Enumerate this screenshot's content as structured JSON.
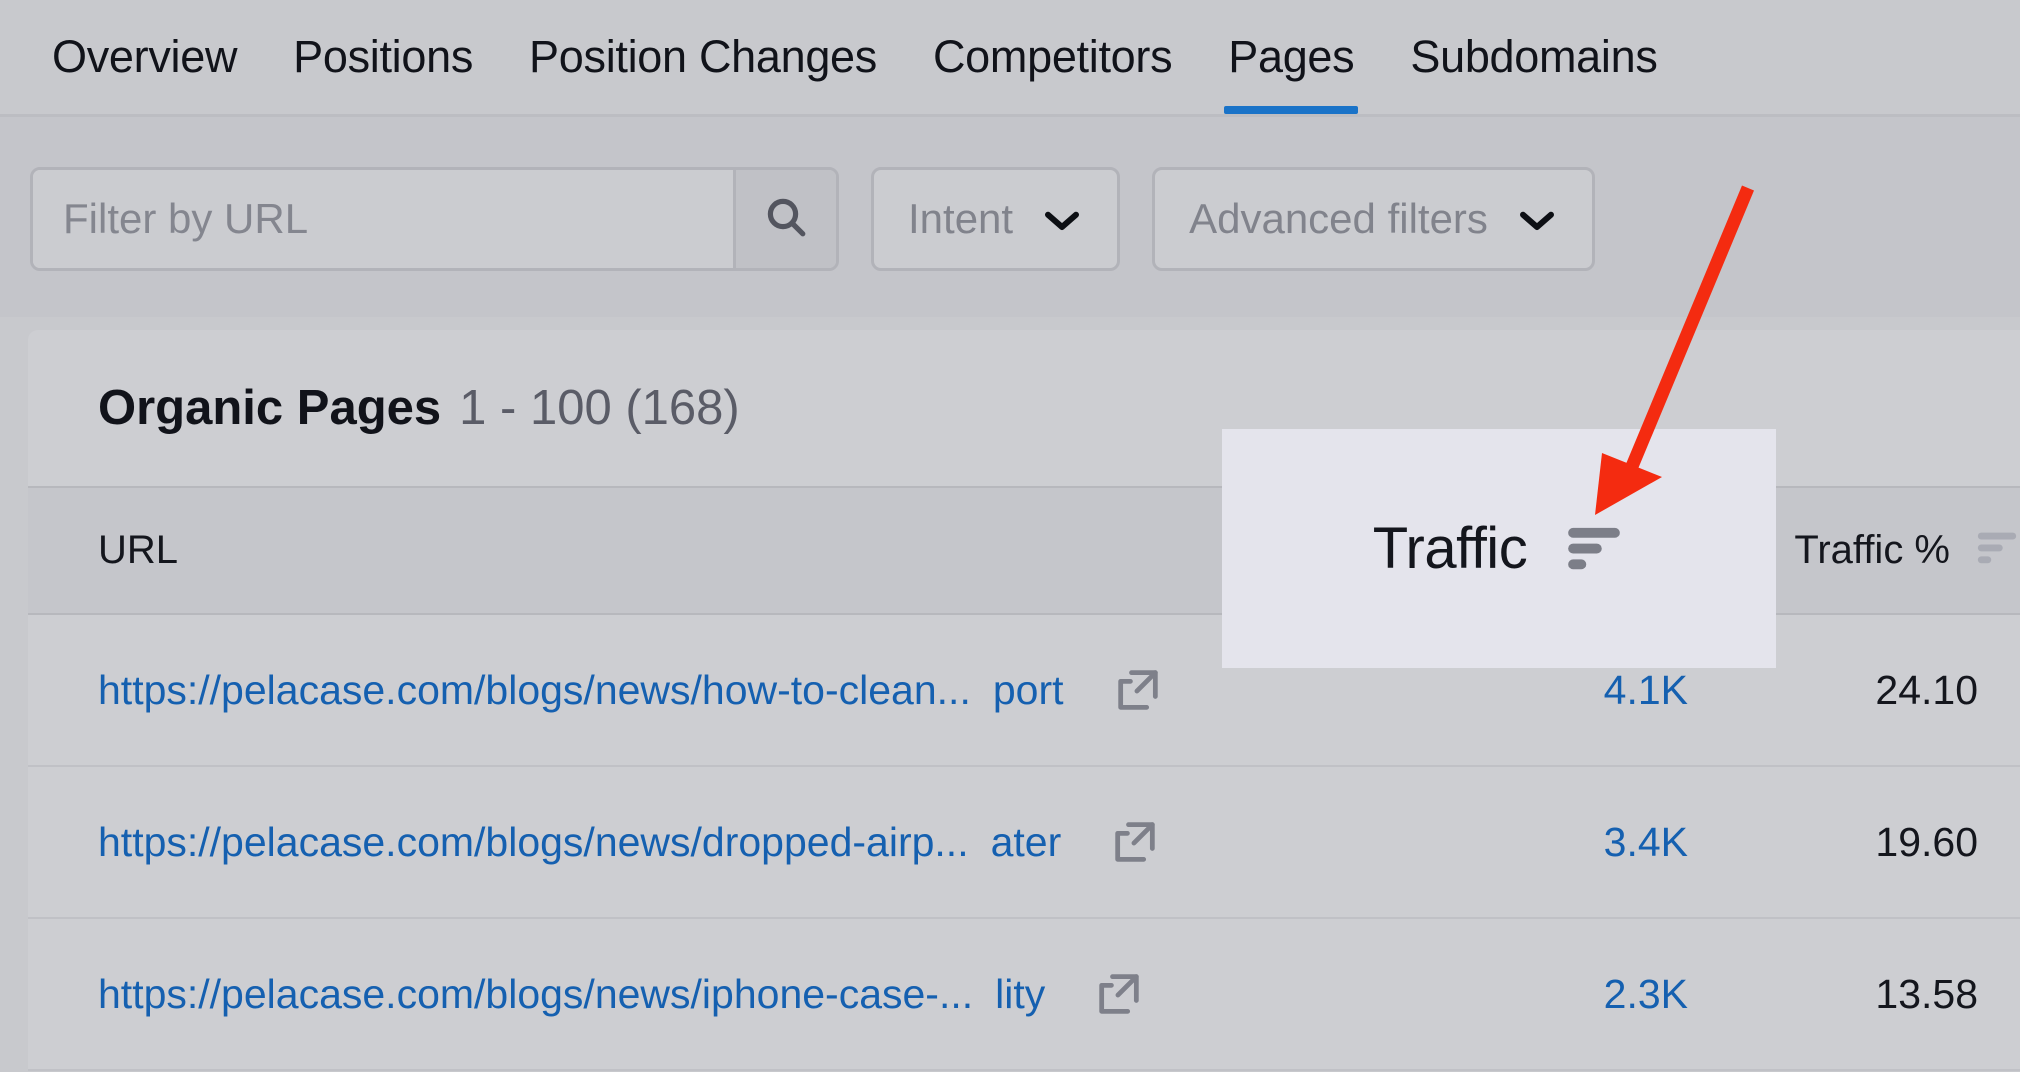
{
  "nav": {
    "tabs": [
      {
        "label": "Overview",
        "active": false
      },
      {
        "label": "Positions",
        "active": false
      },
      {
        "label": "Position Changes",
        "active": false
      },
      {
        "label": "Competitors",
        "active": false
      },
      {
        "label": "Pages",
        "active": true
      },
      {
        "label": "Subdomains",
        "active": false
      }
    ],
    "active_underline_color": "#1a73c8"
  },
  "filters": {
    "url_filter_placeholder": "Filter by URL",
    "url_filter_value": "",
    "search_icon": "search-icon",
    "intent_label": "Intent",
    "advanced_filters_label": "Advanced filters",
    "chevron_icon": "chevron-down-icon"
  },
  "table": {
    "title_strong": "Organic Pages",
    "title_range": "1 - 100 (168)",
    "columns": [
      {
        "key": "url",
        "label": "URL",
        "sortable": false
      },
      {
        "key": "traffic",
        "label": "Traffic",
        "sortable": true,
        "sort_icon": "sort-descending-icon"
      },
      {
        "key": "traffic_pct",
        "label": "Traffic %",
        "sortable": true,
        "sort_icon": "sort-descending-icon"
      }
    ],
    "rows": [
      {
        "url_text": "https://pelacase.com/blogs/news/how-to-clean...",
        "url_suffix": "port",
        "external_link_icon": "external-link-icon",
        "traffic": "4.1K",
        "traffic_pct": "24.10"
      },
      {
        "url_text": "https://pelacase.com/blogs/news/dropped-airp...",
        "url_suffix": "ater",
        "external_link_icon": "external-link-icon",
        "traffic": "3.4K",
        "traffic_pct": "19.60"
      },
      {
        "url_text": "https://pelacase.com/blogs/news/iphone-case-...",
        "url_suffix": "lity",
        "external_link_icon": "external-link-icon",
        "traffic": "2.3K",
        "traffic_pct": "13.58"
      }
    ]
  },
  "overlay": {
    "label": "Traffic",
    "sort_icon": "sort-descending-icon",
    "background": "#e4e4ec"
  },
  "annotation": {
    "arrow_color": "#f42b10",
    "arrow_icon": "red-arrow-annotation"
  },
  "colors": {
    "page_background": "#c8c9cd",
    "link_blue": "#1560b0",
    "accent_blue": "#1a73c8",
    "text_dark": "#14161d",
    "text_muted": "#73757e"
  }
}
